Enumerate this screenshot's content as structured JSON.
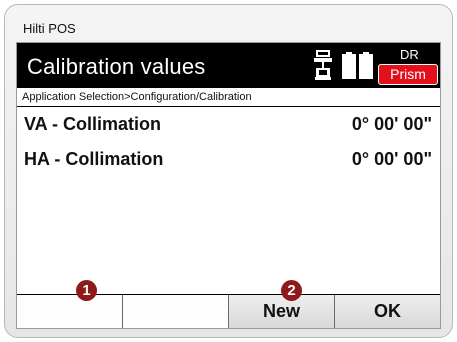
{
  "window": {
    "title": "Hilti POS"
  },
  "header": {
    "title": "Calibration values",
    "mode_label": "DR",
    "target_badge": "Prism",
    "badge_color": "#e3101b",
    "icons": [
      "instrument-icon",
      "battery-icon",
      "battery-icon"
    ]
  },
  "breadcrumb": "Application Selection>Configuration/Calibration",
  "rows": [
    {
      "label": "VA - Collimation",
      "value": "0° 00' 00\""
    },
    {
      "label": "HA - Collimation",
      "value": "0° 00' 00\""
    }
  ],
  "softkeys": [
    "",
    "",
    "New",
    "OK"
  ],
  "callouts": [
    "1",
    "2"
  ],
  "callout_color": "#8d1b1b"
}
